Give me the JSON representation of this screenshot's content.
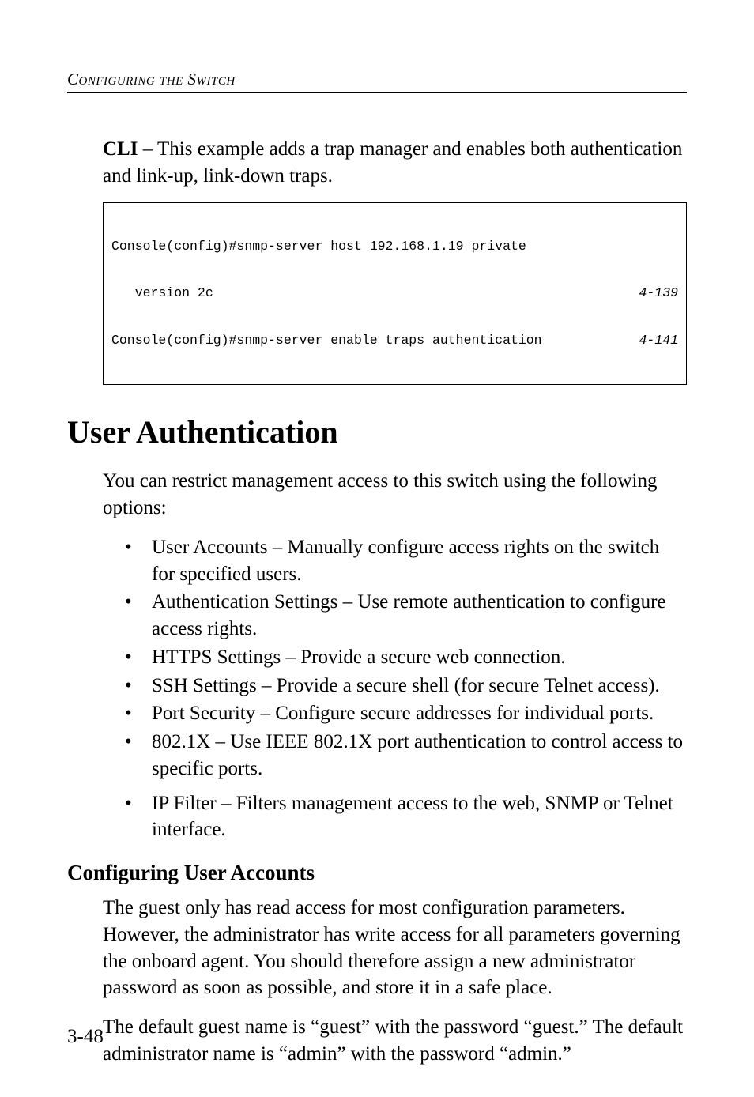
{
  "runningHead": "Configuring the Switch",
  "intro": {
    "boldLead": "CLI",
    "rest": " – This example adds a trap manager and enables both authentication and link-up, link-down traps."
  },
  "code": {
    "line1": "Console(config)#snmp-server host 192.168.1.19 private",
    "line2_left": "   version 2c",
    "line2_ref": "4-139",
    "line3_left": "Console(config)#snmp-server enable traps authentication",
    "line3_ref": "4-141"
  },
  "sectionTitle": "User Authentication",
  "sectionIntro": "You can restrict management access to this switch using the following options:",
  "bullets": [
    "User Accounts – Manually configure access rights on the switch for specified users.",
    "Authentication Settings – Use remote authentication to configure access rights.",
    "HTTPS Settings – Provide a secure web connection.",
    "SSH Settings – Provide a secure shell (for secure Telnet access).",
    "Port Security – Configure secure addresses for individual ports.",
    "802.1X – Use IEEE 802.1X port authentication to control access to specific ports."
  ],
  "bulletLast": "IP Filter – Filters management access to the web, SNMP or Telnet interface.",
  "subsectionTitle": "Configuring User Accounts",
  "subPara1": "The guest only has read access for most configuration parameters. However, the administrator has write access for all parameters governing the onboard agent. You should therefore assign a new administrator password as soon as possible, and store it in a safe place.",
  "subPara2": "The default guest name is “guest” with the password “guest.” The default administrator name is “admin” with the password “admin.”",
  "pageNumber": "3-48"
}
